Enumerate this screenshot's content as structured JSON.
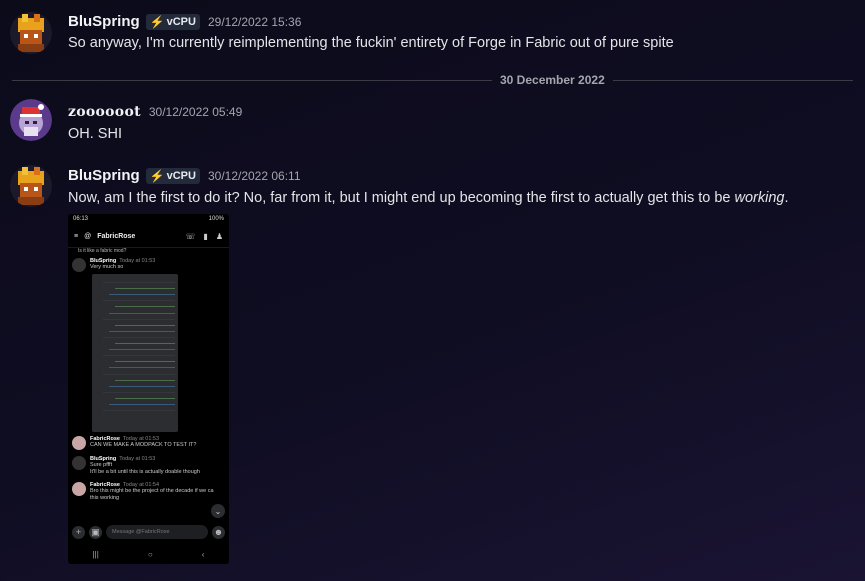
{
  "messages": [
    {
      "username": "BluSpring",
      "role": "vCPU",
      "timestamp": "29/12/2022 15:36",
      "content": "So anyway, I'm currently reimplementing the fuckin' entirety of Forge in Fabric out of pure spite"
    },
    {
      "username": "zoooooot",
      "timestamp": "30/12/2022 05:49",
      "content": "OH. SHI"
    },
    {
      "username": "BluSpring",
      "role": "vCPU",
      "timestamp": "30/12/2022 06:11",
      "content_before": "Now, am I the first to do it? No, far from it, but I might end up becoming the first to actually get this to be ",
      "content_emphasis": "working",
      "content_after": "."
    }
  ],
  "date_divider": "30 December 2022",
  "attachment": {
    "status_time": "06:13",
    "status_battery": "100%",
    "channel_name": "FabricRose",
    "top_lines": [
      "Is it like a fabric mod?"
    ],
    "msgs": [
      {
        "author": "BluSpring",
        "time": "Today at 01:53",
        "text": "Very much so"
      },
      {
        "author": "FabricRose",
        "time": "Today at 01:53",
        "text": "CAN WE MAKE A MODPACK TO TEST IT?"
      },
      {
        "author": "BluSpring",
        "time": "Today at 01:53",
        "text": "Sure pffft",
        "text2": "It'll be a bit until this is actually doable though"
      },
      {
        "author": "FabricRose",
        "time": "Today at 01:54",
        "text": "Bro this might be the project of the decade if we ca",
        "text2": "this working"
      }
    ],
    "input_placeholder": "Message @FabricRose"
  },
  "colors": {
    "role_icon": "#3ba55c",
    "background": "#0f0d22"
  }
}
